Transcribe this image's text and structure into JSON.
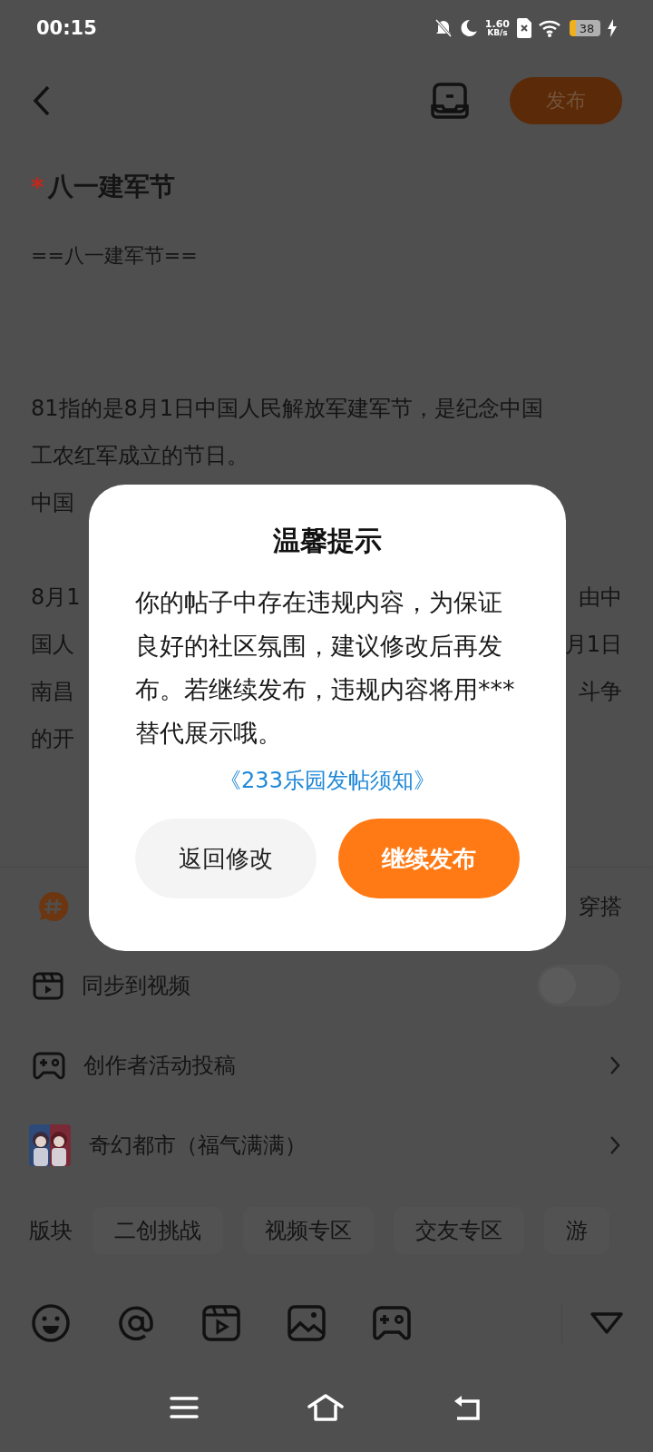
{
  "status_bar": {
    "time": "00:15",
    "net_speed": "1.60",
    "net_unit": "KB/s",
    "battery": "38"
  },
  "header": {
    "publish": "发布"
  },
  "editor": {
    "title": "八一建军节",
    "required_mark": "*",
    "subtitle": "==八一建军节==",
    "lines": [
      {
        "kind": "text",
        "left": "81指的是8月1日中国人民解放军建军节，是纪念中国"
      },
      {
        "kind": "text",
        "left": "工农红军成立的节日。"
      },
      {
        "kind": "text",
        "left": "中国"
      },
      {
        "kind": "blank"
      },
      {
        "kind": "text",
        "left": "8月1",
        "right": "由中"
      },
      {
        "kind": "text",
        "left": "国人",
        "right": "月1日"
      },
      {
        "kind": "text",
        "left": "南昌",
        "right": "斗争"
      },
      {
        "kind": "text",
        "left": "的开"
      }
    ]
  },
  "topic": {
    "text": "穿搭"
  },
  "options": [
    {
      "kind": "toggle",
      "label": "同步到视频",
      "on": false
    },
    {
      "kind": "link",
      "label": "创作者活动投稿"
    },
    {
      "kind": "game",
      "label": "奇幻都市（福气满满）"
    }
  ],
  "sections": {
    "label": "版块",
    "chips": [
      {
        "label": "二创挑战",
        "selected": false
      },
      {
        "label": "视频专区",
        "selected": false
      },
      {
        "label": "交友专区",
        "selected": false
      },
      {
        "label": "游",
        "selected": false
      }
    ]
  },
  "dialog": {
    "title": "温馨提示",
    "message": "你的帖子中存在违规内容，为保证良好的社区氛围，建议修改后再发布。若继续发布，违规内容将用***替代展示哦。",
    "link": "《233乐园发帖须知》",
    "buttons": [
      {
        "kind": "secondary",
        "label": "返回修改"
      },
      {
        "kind": "primary",
        "label": "继续发布"
      }
    ]
  }
}
